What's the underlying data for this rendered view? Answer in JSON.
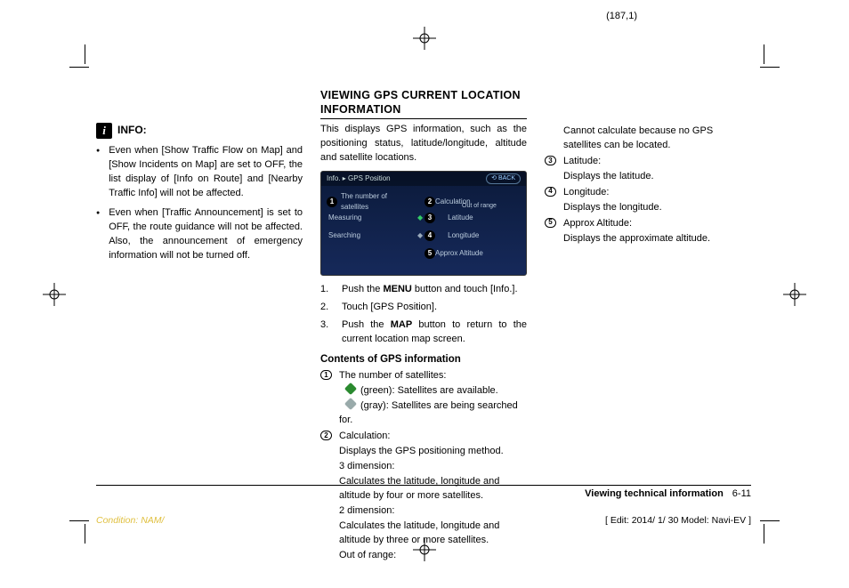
{
  "pageCoord": "(187,1)",
  "col1": {
    "infoLabel": "INFO:",
    "bullets": [
      "Even when [Show Traffic Flow on Map] and [Show Incidents on Map] are set to OFF, the list display of [Info on Route] and [Nearby Traffic Info] will not be affected.",
      "Even when [Traffic Announcement] is set to OFF, the route guidance will not be affected. Also, the announcement of emergency information will not be turned off."
    ]
  },
  "col2": {
    "title": "VIEWING GPS CURRENT LOCATION INFORMATION",
    "intro": "This displays GPS information, such as the positioning status, latitude/longitude, altitude and satellite locations.",
    "screenshot": {
      "topbarLeft": "Info. ▸ GPS Position",
      "back": "BACK",
      "rows": {
        "r1l": "The number of satellites",
        "r1r": "Calculation",
        "r1rsub": "Out of range",
        "r2l": "Measuring",
        "r2r": "Latitude",
        "r3l": "Searching",
        "r3r": "Longitude",
        "r4r": "Approx Altitude"
      }
    },
    "steps": {
      "s1a": "Push the ",
      "s1b": "MENU",
      "s1c": " button and touch [Info.].",
      "s2": "Touch [GPS Position].",
      "s3a": "Push the ",
      "s3b": "MAP",
      "s3c": " button to return to the current location map screen."
    },
    "subhead": "Contents of GPS information",
    "g1": {
      "t": "The number of satellites:",
      "g": "(green): Satellites are available.",
      "gr": "(gray): Satellites are being searched for."
    },
    "g2": {
      "t": "Calculation:",
      "l1": "Displays the GPS positioning method.",
      "l2": "3 dimension:",
      "l3": "Calculates the latitude, longitude and altitude by four or more satellites.",
      "l4": "2 dimension:",
      "l5": "Calculates the latitude, longitude and altitude by three or more satellites.",
      "l6": "Out of range:"
    }
  },
  "col3": {
    "g2cont": "Cannot calculate because no GPS satellites can be located.",
    "g3": {
      "t": "Latitude:",
      "d": "Displays the latitude."
    },
    "g4": {
      "t": "Longitude:",
      "d": "Displays the longitude."
    },
    "g5": {
      "t": "Approx Altitude:",
      "d": "Displays the approximate altitude."
    }
  },
  "footer": {
    "section": "Viewing technical information",
    "pageNum": "6-11",
    "edit": "[ Edit: 2014/ 1/ 30   Model:  Navi-EV ]",
    "condition": "Condition: NAM/"
  }
}
